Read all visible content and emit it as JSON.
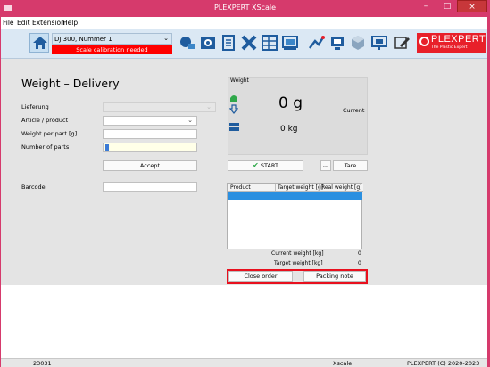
{
  "window": {
    "title": "PLEXPERT XScale",
    "controls": [
      "–",
      "□",
      "×"
    ]
  },
  "menu": [
    "File",
    "Edit",
    "Extension",
    "Help"
  ],
  "toolbar": {
    "scale_selected": "DJ 300, Nummer 1",
    "calibration_warning": "Scale calibration needed",
    "icons": [
      "home-icon",
      "scale-icon",
      "settings-icon",
      "document-icon",
      "tools-icon",
      "grid-icon",
      "monitor-icon",
      "chart-icon",
      "support-icon",
      "cube-icon",
      "presentation-icon",
      "edit-icon"
    ],
    "logo_text": "PLEXPERT",
    "logo_subtext": "The Plastic Expert"
  },
  "form": {
    "title": "Weight – Delivery",
    "fields": [
      {
        "label": "Lieferung",
        "value": "",
        "chevron": "⌄"
      },
      {
        "label": "Article / product",
        "value": "",
        "chevron": "⌄"
      },
      {
        "label": "Weight per part [g]",
        "value": ""
      },
      {
        "label": "Number of parts",
        "value": ""
      }
    ],
    "accept_label": "Accept",
    "barcode_label": "Barcode",
    "barcode_value": ""
  },
  "weight": {
    "caption": "Weight",
    "value": "0 g",
    "mode": "Current",
    "value_kg": "0 kg",
    "start_label": "START",
    "more_label": "...",
    "tare_label": "Tare"
  },
  "table": {
    "columns": [
      "Product",
      "Target weight [g]",
      "Real weight [g]"
    ],
    "rows": []
  },
  "summary": {
    "current_label": "Current weight [kg]",
    "current_value": "0",
    "target_label": "Target weight [kg]",
    "target_value": "0"
  },
  "actions": {
    "close_order": "Close order",
    "packing_note": "Packing note"
  },
  "status": {
    "left": "23031",
    "middle": "Xscale",
    "right": "PLEXPERT (C) 2020-2023"
  }
}
